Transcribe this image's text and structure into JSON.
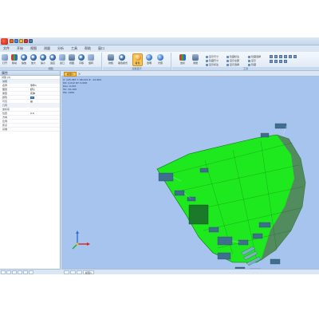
{
  "menu": [
    "文件",
    "开始",
    "视图",
    "测量",
    "分析",
    "工具",
    "帮助",
    "窗口"
  ],
  "ribbon": {
    "group_view_label": "视图",
    "group_render_label": "渲染显示",
    "group_tools_label": "工具",
    "view_tools": [
      {
        "label": "打开",
        "icon": "open-icon"
      },
      {
        "label": "移动",
        "icon": "move-icon"
      },
      {
        "label": "缩放",
        "icon": "zoom-icon"
      },
      {
        "label": "放大",
        "icon": "zoom-in-icon"
      },
      {
        "label": "缩小",
        "icon": "zoom-out-icon"
      },
      {
        "label": "适应",
        "icon": "fit-icon"
      },
      {
        "label": "窗口",
        "icon": "window-zoom-icon"
      },
      {
        "label": "视图",
        "icon": "view-icon"
      },
      {
        "label": "平移",
        "icon": "pan-icon"
      },
      {
        "label": "旋转",
        "icon": "rotate-icon"
      }
    ],
    "render_tools": [
      {
        "label": "线框",
        "icon": "wireframe-icon"
      },
      {
        "label": "着色模式",
        "icon": "shaded-mode-icon"
      },
      {
        "label": "着色",
        "icon": "shaded-icon"
      },
      {
        "label": "透明",
        "icon": "transparent-icon"
      },
      {
        "label": "光照",
        "icon": "light-icon"
      }
    ],
    "right_tools": [
      {
        "label": "坐标",
        "icon": "axes-icon"
      },
      {
        "label": "测量",
        "icon": "measure-icon"
      }
    ],
    "text_buttons": [
      "显示尺寸",
      "隐藏尺寸",
      "显示标注",
      "隐藏标注",
      "显示全部",
      "显示选择",
      "隐藏选择",
      "显示",
      "隐藏"
    ]
  },
  "left_panel": {
    "header": "属性",
    "title": "对象 (2)",
    "section_general": "常规",
    "section_geometry": "几何",
    "rows": [
      {
        "key": "名称",
        "value": "零件1"
      },
      {
        "key": "图层",
        "value": "默认"
      },
      {
        "key": "类型",
        "value": "实体"
      },
      {
        "key": "颜色",
        "value": ""
      },
      {
        "key": "可见",
        "value": "是"
      }
    ],
    "geo_rows": [
      {
        "key": "坐标系",
        "value": ""
      },
      {
        "key": "位置",
        "value": "0.0"
      },
      {
        "key": "方向",
        "value": ""
      },
      {
        "key": "比例",
        "value": ""
      },
      {
        "key": "原点",
        "value": ""
      },
      {
        "key": "基准",
        "value": ""
      }
    ]
  },
  "viewport": {
    "tab_label": "模型1",
    "close_glyph": "×",
    "readout": [
      "X: 125.387  Y: 48.215  Z: -12.904",
      "DX: 0.012  DY: 0.008",
      "Dev: 0.015",
      "Tol: ±0.100",
      "Pts: 1284"
    ],
    "bottom_tab_label": "模型1"
  },
  "colors": {
    "viewport_bg": "#a7c4ee",
    "model": "#1ee81e",
    "annotation": "#3f6f8f"
  }
}
